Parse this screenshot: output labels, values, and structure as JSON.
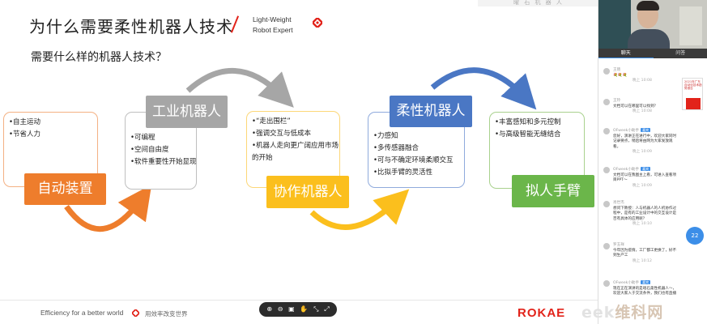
{
  "slide": {
    "top_strip": "曜 石 机 器 人",
    "title": "为什么需要柔性机器人技术",
    "brand_line1": "Light-Weight",
    "brand_line2": "Robot Expert",
    "subtitle": "需要什么样的机器人技术？",
    "stages": [
      {
        "label": "自动装置",
        "items": [
          "•自主运动",
          "•节省人力"
        ],
        "color": "#ee7d2c"
      },
      {
        "label": "工业机器人",
        "items": [
          "•可编程",
          "•空间自由度",
          "•软件重要性开始显现"
        ],
        "color": "#a6a6a6"
      },
      {
        "label": "协作机器人",
        "items": [
          "•“走出围栏”",
          "•强调交互与低成本",
          "•机器人走向更广阔应用市场",
          "的开始"
        ],
        "color": "#fbbf1d"
      },
      {
        "label": "柔性机器人",
        "items": [
          "•力感知",
          "•多传感器融合",
          "•可与不确定环境柔顺交互",
          "•比拟手臂的灵活性"
        ],
        "color": "#4a77c4"
      },
      {
        "label": "拟人手臂",
        "items": [
          "•丰富感知和多元控制",
          "•与高级智能无缝结合"
        ],
        "color": "#6bb64a"
      }
    ],
    "footer_en": "Efficiency for a better world",
    "footer_cn": "用效率改变世界",
    "logo": "ROKAE",
    "toolbar": [
      "⊕",
      "⊖",
      "▣",
      "✋",
      "⤡",
      "⤢"
    ]
  },
  "panel": {
    "tabs": [
      "聊天",
      "问答"
    ],
    "messages": [
      {
        "name": "王晓",
        "badge": "",
        "body": "💐💐💐",
        "time": "晚上 10:08"
      },
      {
        "name": "王玲",
        "badge": "",
        "body": "文档可以在哪里可以找到？",
        "time": "晚上 10:08"
      },
      {
        "name": "OFweek小助手",
        "badge": "嘉宾",
        "body": "您好，演讲正在进行中，欢迎大家同时记录要点，稍后将由网为大家发放观看。",
        "time": "晚上 10:09"
      },
      {
        "name": "OFweek小助手",
        "badge": "嘉宾",
        "body": "文档可以在我图主上看，可进入查看项目PPT～",
        "time": "晚上 10:09"
      },
      {
        "name": "肖世杰",
        "badge": "",
        "body": "想问下教授：人与机器人的人机协作过程中，是有的工业设计中的交互设计是否有具体的应用呢？",
        "time": "晚上 10:10"
      },
      {
        "name": "罗玉祥",
        "badge": "",
        "body": "今年因为疫情，工厂都工更换了，好不到生产工",
        "time": "晚上 10:12"
      },
      {
        "name": "OFweek小助手",
        "badge": "嘉宾",
        "body": "现在正在演讲的是珞石柔性机器人～，欢迎大家入于交流条件，我们也有直播",
        "time": ""
      }
    ],
    "ad_text": "2021年广东自动化技术趋势报告",
    "float_label": "22",
    "watermark_pre": "eek",
    "watermark_main": "维科网"
  }
}
